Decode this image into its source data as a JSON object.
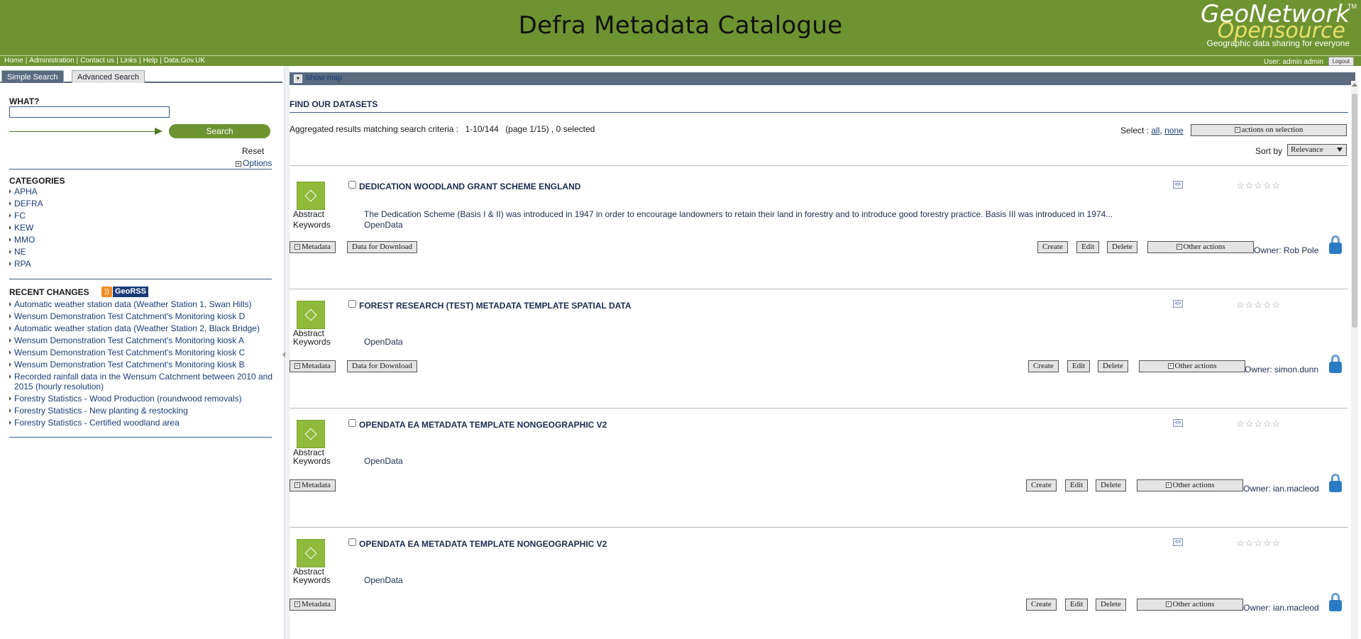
{
  "header": {
    "title": "Defra Metadata Catalogue",
    "logo_top": "GeoNetwork",
    "logo_tm": "TM",
    "logo_mid": "Opensource",
    "logo_tagline": "Geographic data sharing for everyone"
  },
  "nav": {
    "items": [
      "Home",
      "Administration",
      "Contact us",
      "Links",
      "Help",
      "Data.Gov.UK"
    ],
    "user_label": "User: admin admin",
    "logout_label": "Logout"
  },
  "sidebar": {
    "tabs": [
      "Simple Search",
      "Advanced Search"
    ],
    "what_label": "WHAT?",
    "search_value": "",
    "search_button": "Search",
    "reset_label": "Reset",
    "options_label": "Options",
    "categories_title": "CATEGORIES",
    "categories": [
      "APHA",
      "DEFRA",
      "FC",
      "KEW",
      "MMO",
      "NE",
      "RPA"
    ],
    "recent_title": "RECENT CHANGES",
    "georss_label": "GeoRSS",
    "recent": [
      "Automatic weather station data (Weather Station 1, Swan Hills)",
      "Wensum Demonstration Test Catchment's Monitoring kiosk D",
      "Automatic weather station data (Weather Station 2, Black Bridge)",
      "Wensum Demonstration Test Catchment's Monitoring kiosk A",
      "Wensum Demonstration Test Catchment's Monitoring kiosk C",
      "Wensum Demonstration Test Catchment's Monitoring kiosk B",
      "Recorded rainfall data in the Wensum Catchment between 2010 and 2015 (hourly resolution)",
      "Forestry Statistics - Wood Production (roundwood removals)",
      "Forestry Statistics - New planting & restocking",
      "Forestry Statistics - Certified woodland area"
    ]
  },
  "main": {
    "show_map": "Show map",
    "find_title": "FIND OUR DATASETS",
    "agg_prefix": "Aggregated results matching search criteria :",
    "agg_range": "1-10/144",
    "agg_page": "(page 1/15)",
    "agg_selected": "0 selected",
    "select_prefix": "Select :",
    "select_all": "all",
    "select_none": "none",
    "actions_on_selection": "actions on selection",
    "sort_label": "Sort by",
    "sort_value": "Relevance",
    "labels": {
      "abstract": "Abstract",
      "keywords": "Keywords",
      "metadata": "Metadata",
      "download": "Data for Download",
      "create": "Create",
      "edit": "Edit",
      "delete": "Delete",
      "other_actions": "Other actions"
    },
    "records": [
      {
        "title": "DEDICATION WOODLAND GRANT SCHEME ENGLAND",
        "abstract": "The Dedication Scheme (Basis I & II) was introduced in 1947 in order to encourage landowners to retain their land in forestry and to introduce good forestry practice. Basis III was introduced in 1974...",
        "keywords": "OpenData",
        "owner": "Owner: Rob Pole",
        "has_download": true
      },
      {
        "title": "FOREST RESEARCH (TEST) METADATA TEMPLATE SPATIAL DATA",
        "abstract": "",
        "keywords": "OpenData",
        "owner": "Owner: simon.dunn",
        "has_download": true
      },
      {
        "title": "OPENDATA EA METADATA TEMPLATE NONGEOGRAPHIC V2",
        "abstract": "",
        "keywords": "OpenData",
        "owner": "Owner: ian.macleod",
        "has_download": false
      },
      {
        "title": "OPENDATA EA METADATA TEMPLATE NONGEOGRAPHIC V2",
        "abstract": "",
        "keywords": "OpenData",
        "owner": "Owner: ian.macleod",
        "has_download": false
      }
    ]
  },
  "colors": {
    "banner": "#6e9331",
    "tab_active": "#5a6b80",
    "link": "#1a3c78"
  }
}
